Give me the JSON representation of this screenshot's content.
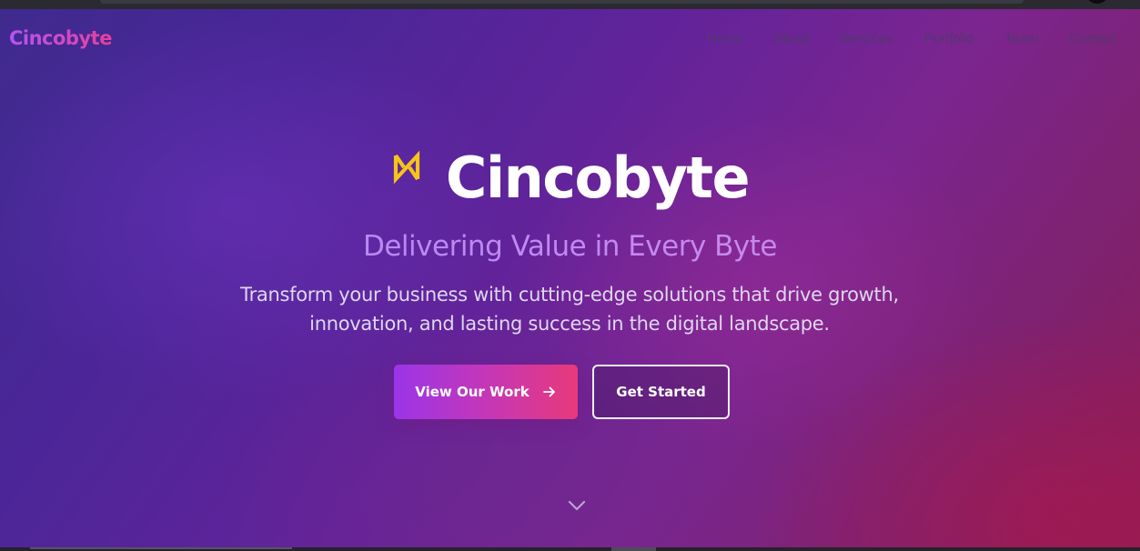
{
  "nav": {
    "brand": "Cincobyte",
    "items": [
      {
        "label": "Home"
      },
      {
        "label": "About"
      },
      {
        "label": "Services"
      },
      {
        "label": "Portfolio"
      },
      {
        "label": "Team"
      },
      {
        "label": "Contact"
      }
    ]
  },
  "hero": {
    "logo_icon": "bowtie-logo-icon",
    "title": "Cincobyte",
    "tagline": "Delivering Value in Every Byte",
    "description_line1": "Transform your business with cutting-edge solutions that drive growth,",
    "description_line2": "innovation, and lasting success in the digital landscape.",
    "primary_button": "View Our Work",
    "primary_button_icon": "arrow-right-icon",
    "secondary_button": "Get Started",
    "scroll_icon": "chevron-down-icon"
  },
  "colors": {
    "logo_icon": "#f5c518",
    "brand_gradient_start": "#b455f2",
    "brand_gradient_end": "#e7409a",
    "nav_text": "#52386f",
    "button_gradient_start": "#9a35e8",
    "button_gradient_end": "#e8397a"
  }
}
